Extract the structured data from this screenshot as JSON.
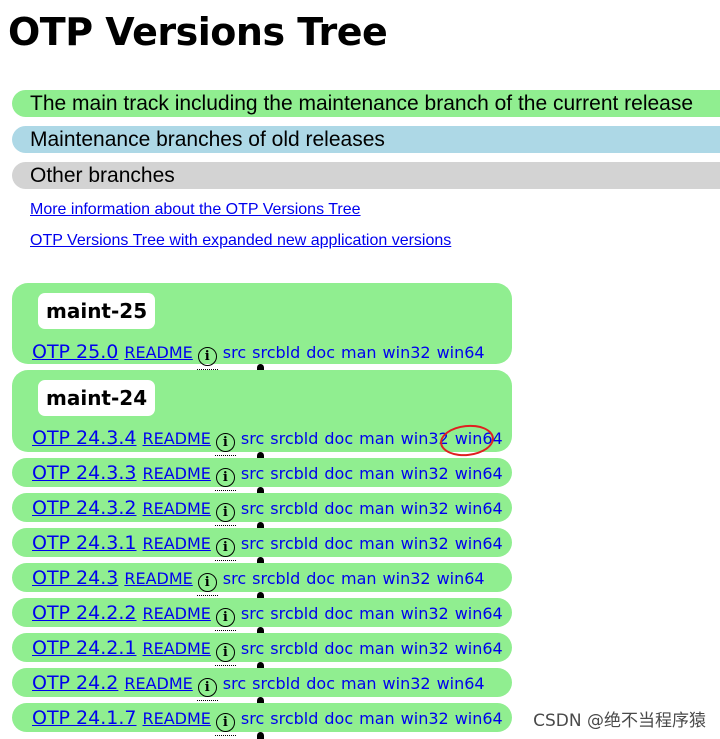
{
  "page": {
    "title": "OTP Versions Tree"
  },
  "legend": {
    "main_track": "The main track including the maintenance branch of the current release",
    "maintenance": "Maintenance branches of old releases",
    "other": "Other branches"
  },
  "links": {
    "more_info": "More information about the OTP Versions Tree",
    "expanded": "OTP Versions Tree with expanded new application versions"
  },
  "common": {
    "readme": "README",
    "info_glyph": "i",
    "downloads": [
      "src",
      "srcbld",
      "doc",
      "man",
      "win32",
      "win64"
    ]
  },
  "branches": [
    {
      "label": "maint-25",
      "versions": [
        "OTP 25.0"
      ]
    },
    {
      "label": "maint-24",
      "versions": [
        "OTP 24.3.4",
        "OTP 24.3.3",
        "OTP 24.3.2",
        "OTP 24.3.1",
        "OTP 24.3",
        "OTP 24.2.2",
        "OTP 24.2.1",
        "OTP 24.2",
        "OTP 24.1.7"
      ]
    }
  ],
  "colors": {
    "main_track": "#90ee90",
    "maintenance": "#add8e6",
    "other": "#d3d3d3",
    "link": "#0000ee",
    "annotation": "#e02020"
  },
  "watermark": "CSDN @绝不当程序猿"
}
